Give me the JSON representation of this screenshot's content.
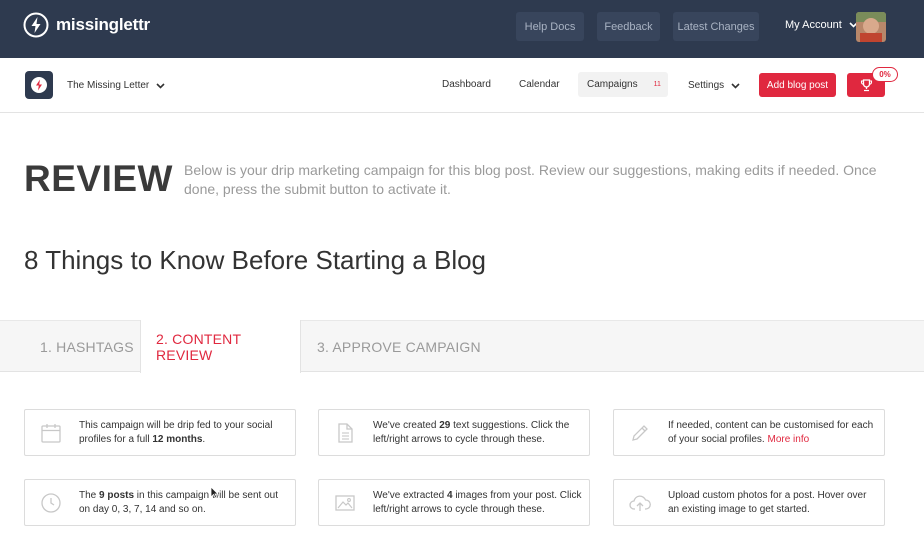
{
  "brand": {
    "name": "missinglettr"
  },
  "topbar": {
    "help_docs": "Help Docs",
    "feedback": "Feedback",
    "latest_changes": "Latest Changes",
    "my_account": "My Account"
  },
  "subnav": {
    "site_name": "The Missing Letter",
    "dashboard": "Dashboard",
    "calendar": "Calendar",
    "campaigns": "Campaigns",
    "campaigns_count": "11",
    "settings": "Settings",
    "add_blog_post": "Add blog post",
    "progress_percent": "0%"
  },
  "review": {
    "heading": "REVIEW",
    "description": "Below is your drip marketing campaign for this blog post. Review our suggestions, making edits if needed. Once done, press the submit button to activate it."
  },
  "post_title": "8 Things to Know Before Starting a Blog",
  "tabs": [
    {
      "label": "1. HASHTAGS",
      "active": false
    },
    {
      "label": "2. CONTENT REVIEW",
      "active": true
    },
    {
      "label": "3. APPROVE CAMPAIGN",
      "active": false
    }
  ],
  "cards": {
    "drip": {
      "icon": "calendar-icon",
      "pre": "This campaign will be drip fed to your social profiles for a full ",
      "bold": "12 months",
      "post": "."
    },
    "suggestions": {
      "icon": "document-icon",
      "pre": "We've created ",
      "bold": "29",
      "post": " text suggestions. Click the left/right arrows to cycle through these."
    },
    "customise": {
      "icon": "pencil-icon",
      "pre": "If needed, content can be customised for each of your social profiles. ",
      "link": "More info"
    },
    "schedule": {
      "icon": "clock-icon",
      "pre": "The ",
      "bold": "9 posts",
      "post": " in this campaign will be sent out on day 0, 3, 7, 14 and so on."
    },
    "images": {
      "icon": "image-icon",
      "pre": "We've extracted ",
      "bold": "4",
      "post": " images from your post. Click left/right arrows to cycle through these."
    },
    "upload": {
      "icon": "cloud-upload-icon",
      "pre": "Upload custom photos for a post. Hover over an existing image to get started."
    }
  },
  "colors": {
    "topbar": "#2e3a4f",
    "accent": "#e0283f",
    "muted_text": "#9a9a9a"
  }
}
